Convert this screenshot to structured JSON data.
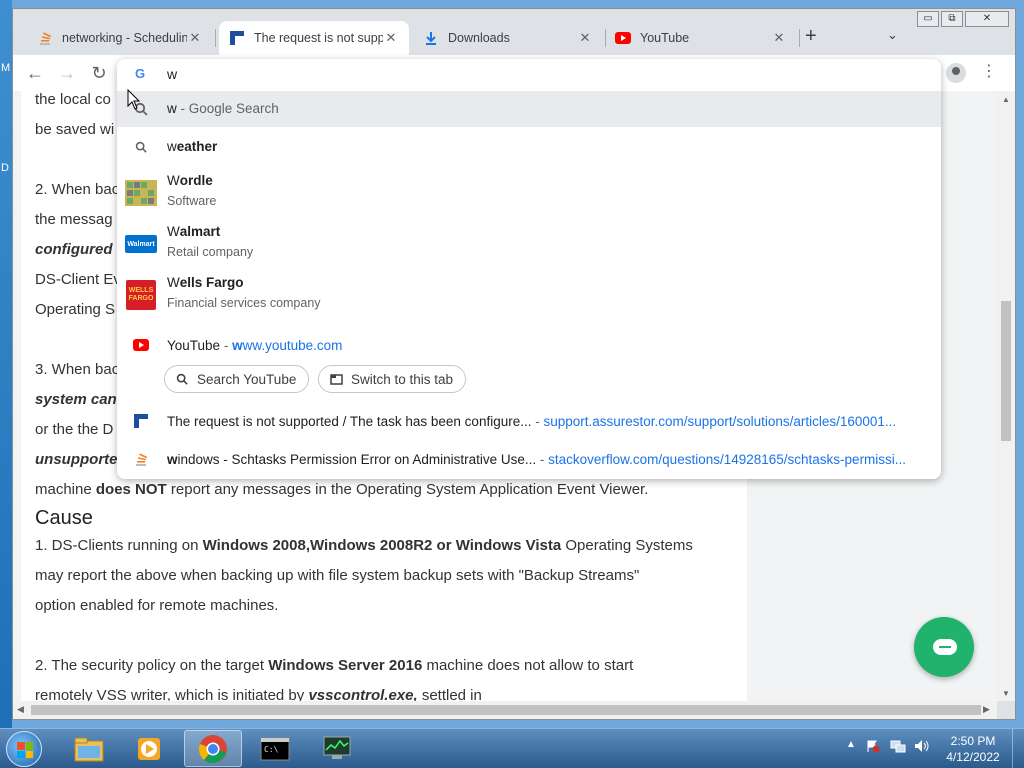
{
  "desktop": {
    "edge_letters": [
      "M",
      "D"
    ]
  },
  "window": {
    "controls": {
      "minimize": "▭",
      "maximize": "⧉",
      "close": "✕"
    }
  },
  "tabs": [
    {
      "title": "networking - Scheduling",
      "icon": "stackoverflow-icon",
      "active": false
    },
    {
      "title": "The request is not suppo",
      "icon": "assurestor-icon",
      "active": true
    },
    {
      "title": "Downloads",
      "icon": "download-icon",
      "active": false
    },
    {
      "title": "YouTube",
      "icon": "youtube-icon",
      "active": false
    }
  ],
  "toolbar": {
    "new_tab": "+",
    "tab_search": "⌄",
    "back": "←",
    "forward": "→",
    "reload": "↻",
    "menu": "⋮"
  },
  "omnibox": {
    "input_value": "w",
    "suggestions": {
      "google": {
        "query": "w",
        "suffix": " - Google Search"
      },
      "weather": {
        "bold": "eather",
        "first": "w"
      },
      "wordle": {
        "first": "W",
        "rest": "ordle",
        "sub": "Software"
      },
      "walmart": {
        "first": "W",
        "rest": "almart",
        "sub": "Retail company"
      },
      "wellsfargo": {
        "first": "W",
        "rest": "ells Fargo",
        "sub": "Financial services company"
      },
      "youtube": {
        "title": "YouTube",
        "sep": " - ",
        "url_match": "w",
        "url_rest": "ww.youtube.com"
      },
      "assurestor": {
        "title": "The request is not supported / The task has been configure...",
        "sep": " - ",
        "url": "support.assurestor.com/support/solutions/articles/160001..."
      },
      "stackoverflow": {
        "first": "w",
        "title_rest": "indows - Schtasks Permission Error on Administrative Use...",
        "sep": " - ",
        "url": "stackoverflow.com/questions/14928165/schtasks-permissi..."
      }
    },
    "chips": {
      "search_youtube": "Search YouTube",
      "switch_tab": "Switch to this tab"
    },
    "logos": {
      "walmart": "Walmart",
      "wellsfargo_l1": "WELLS",
      "wellsfargo_l2": "FARGO"
    }
  },
  "article": {
    "l1": "the local co",
    "l2": "be saved wi",
    "l3": "2. When bac",
    "l4": "the messag",
    "l5": "configured",
    "l6": "DS-Client Ev",
    "l7": "Operating S",
    "l8": "3. When bac",
    "l9": "system can",
    "l10": "or the the D",
    "l11": "unsupporte",
    "l12_a": "machine ",
    "l12_b": "does NOT",
    "l12_c": " report any messages in the Operating System Application Event Viewer.",
    "cause": "Cause",
    "c1_a": "1. DS-Clients running on ",
    "c1_b": "Windows 2008,Windows 2008R2 or Windows Vista",
    "c1_c": " Operating Systems",
    "c2": "may report the above when backing up with file system backup sets with \"Backup Streams\"",
    "c3": "option enabled for remote machines.",
    "c4_a": "2. The security policy on the target ",
    "c4_b": "Windows Server 2016",
    "c4_c": " machine does not allow to start",
    "c5_a": "remotely VSS writer, which is initiated by ",
    "c5_b": "vsscontrol.exe,",
    "c5_c": " settled in"
  },
  "taskbar": {
    "items": [
      "explorer-icon",
      "media-player-icon",
      "chrome-icon",
      "cmd-icon",
      "task-manager-icon"
    ],
    "clock": {
      "time": "2:50 PM",
      "date": "4/12/2022"
    }
  },
  "colors": {
    "accent": "#1a73e8",
    "chat": "#21b36c",
    "youtube": "#ff0000"
  }
}
